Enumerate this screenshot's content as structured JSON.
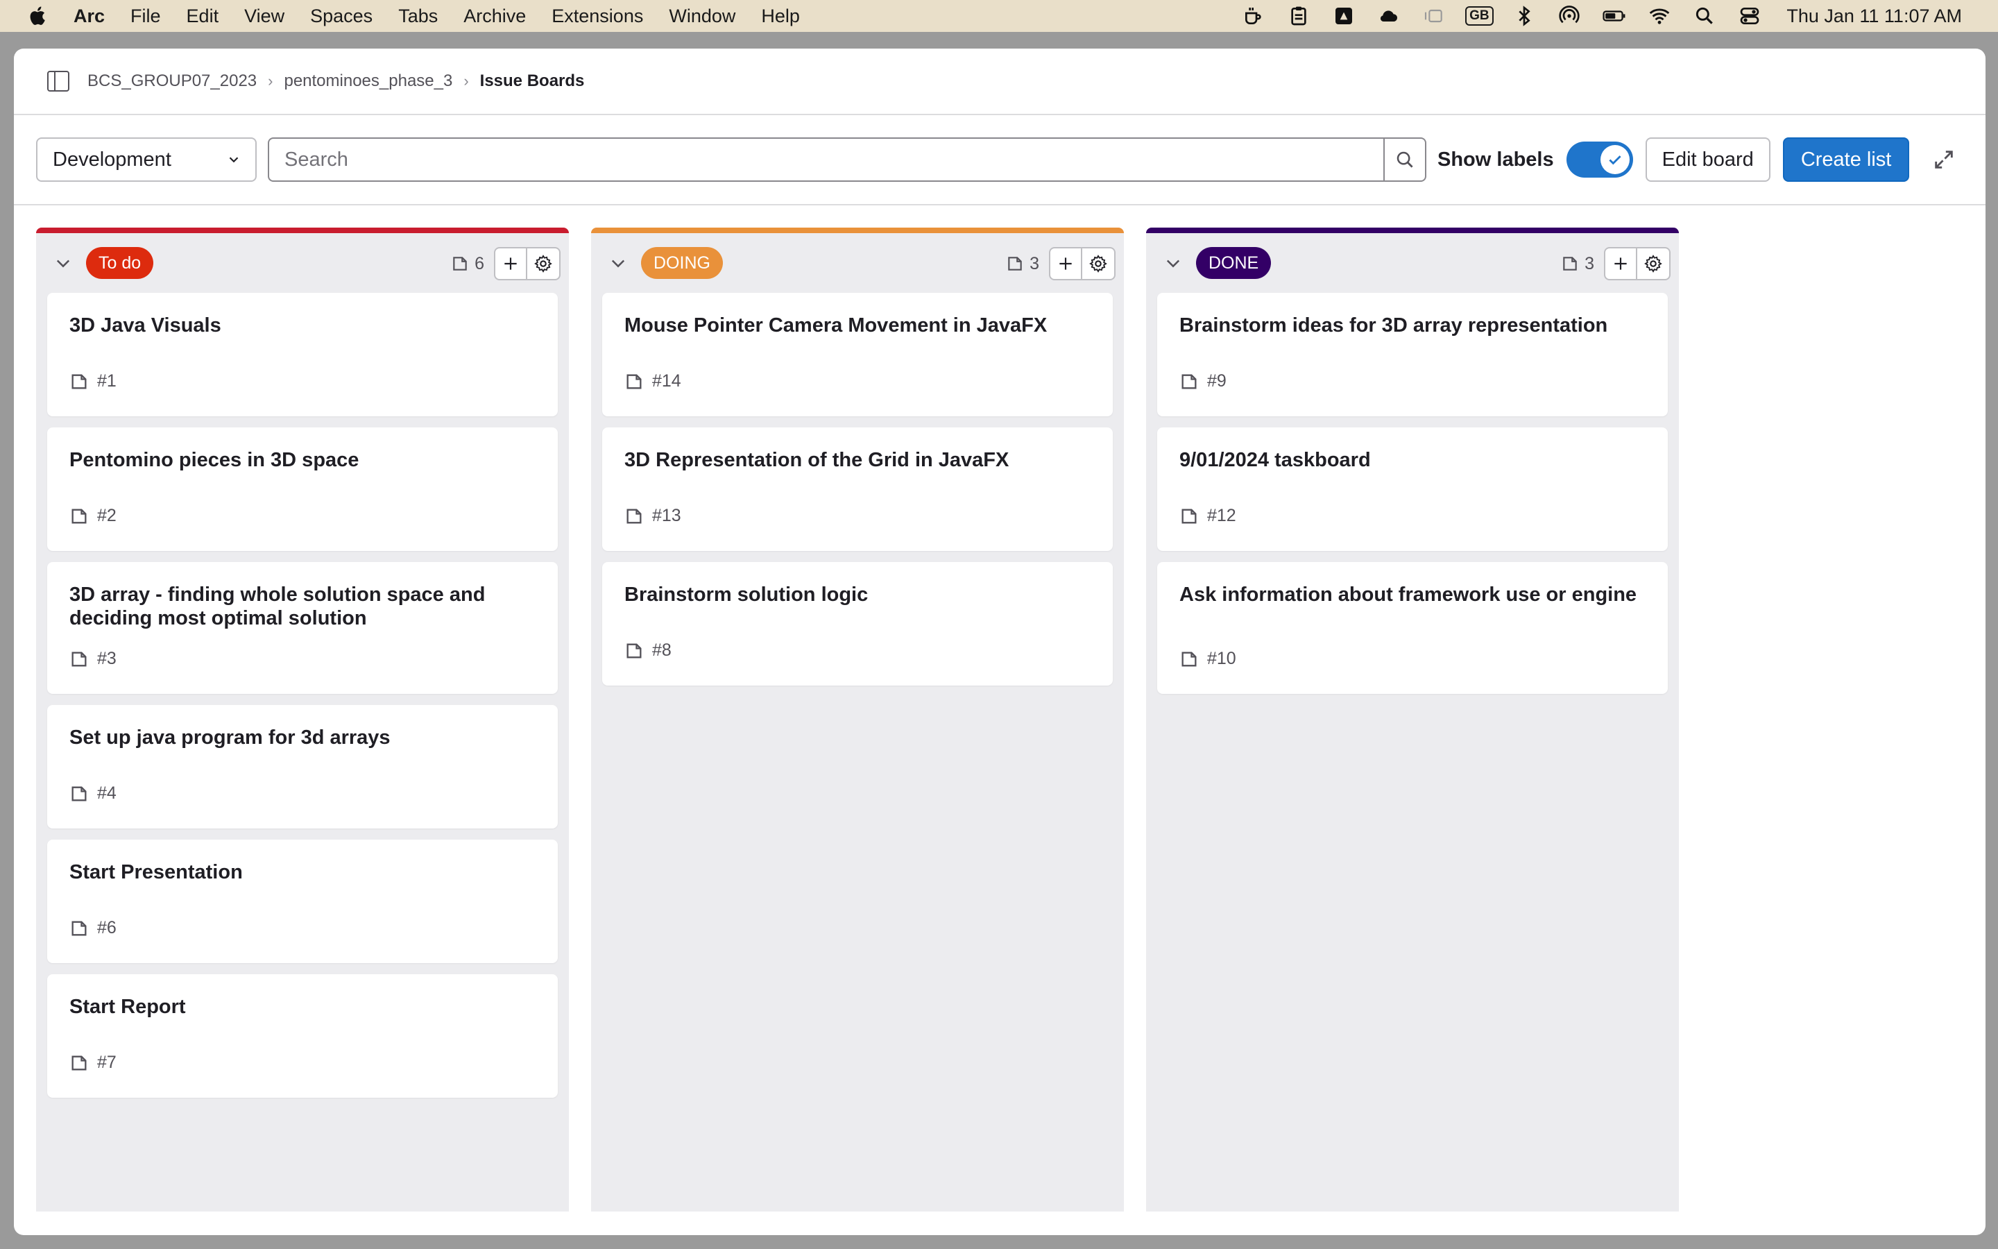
{
  "menubar": {
    "app_name": "Arc",
    "items": [
      "File",
      "Edit",
      "View",
      "Spaces",
      "Tabs",
      "Archive",
      "Extensions",
      "Window",
      "Help"
    ],
    "input_source": "GB",
    "clock": "Thu Jan 11  11:07 AM"
  },
  "breadcrumb": {
    "items": [
      "BCS_GROUP07_2023",
      "pentominoes_phase_3",
      "Issue Boards"
    ]
  },
  "toolbar": {
    "board_select": "Development",
    "search_placeholder": "Search",
    "show_labels": "Show labels",
    "show_labels_enabled": true,
    "edit_board": "Edit board",
    "create_list": "Create list"
  },
  "columns": [
    {
      "label": "To do",
      "color": "#dd2b0e",
      "stripe": "#c91c2e",
      "count": "6",
      "cards": [
        {
          "title": "3D Java Visuals",
          "id": "#1"
        },
        {
          "title": "Pentomino pieces in 3D space",
          "id": "#2"
        },
        {
          "title": "3D array - finding whole solution space and deciding most optimal solution",
          "id": "#3"
        },
        {
          "title": "Set up java program for 3d arrays",
          "id": "#4"
        },
        {
          "title": "Start Presentation",
          "id": "#6"
        },
        {
          "title": "Start Report",
          "id": "#7"
        }
      ]
    },
    {
      "label": "DOING",
      "color": "#e9913a",
      "stripe": "#e9913a",
      "count": "3",
      "cards": [
        {
          "title": "Mouse Pointer Camera Movement in JavaFX",
          "id": "#14"
        },
        {
          "title": "3D Representation of the Grid in JavaFX",
          "id": "#13"
        },
        {
          "title": "Brainstorm solution logic",
          "id": "#8"
        }
      ]
    },
    {
      "label": "DONE",
      "color": "#330066",
      "stripe": "#330066",
      "count": "3",
      "cards": [
        {
          "title": "Brainstorm ideas for 3D array representation",
          "id": "#9"
        },
        {
          "title": "9/01/2024 taskboard",
          "id": "#12"
        },
        {
          "title": "Ask information about framework use or engine",
          "id": "#10"
        }
      ]
    }
  ]
}
